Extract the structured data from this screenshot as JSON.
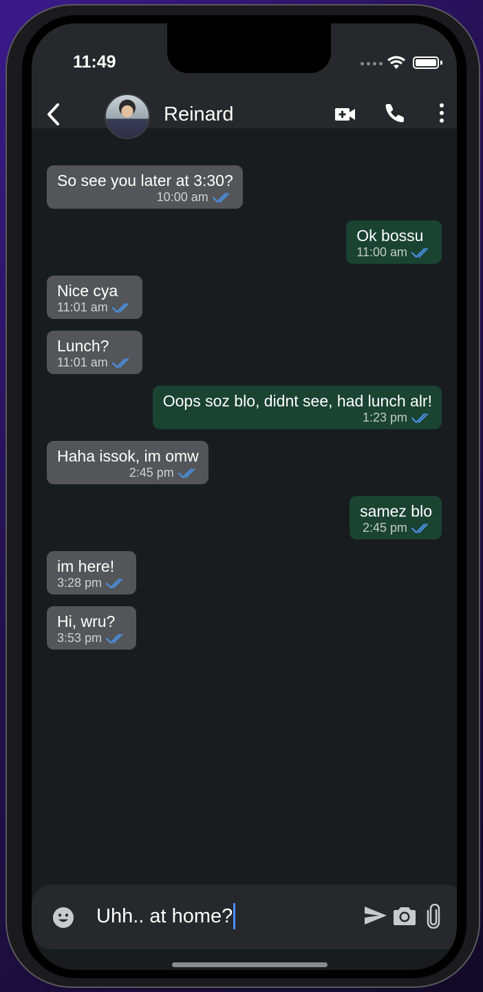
{
  "status_bar": {
    "time": "11:49"
  },
  "header": {
    "contact_name": "Reinard"
  },
  "messages": [
    {
      "direction": "in",
      "text": "So see you later at 3:30?",
      "time": "10:00 am"
    },
    {
      "direction": "out",
      "text": "Ok bossu",
      "time": "11:00 am"
    },
    {
      "direction": "in",
      "text": "Nice cya",
      "time": "11:01 am"
    },
    {
      "direction": "in",
      "text": "Lunch?",
      "time": "11:01 am"
    },
    {
      "direction": "out",
      "text": "Oops soz blo, didnt see, had lunch alr!",
      "time": "1:23 pm"
    },
    {
      "direction": "in",
      "text": "Haha issok, im omw",
      "time": "2:45 pm"
    },
    {
      "direction": "out",
      "text": "samez blo",
      "time": "2:45 pm"
    },
    {
      "direction": "in",
      "text": "im here!",
      "time": "3:28 pm"
    },
    {
      "direction": "in",
      "text": "Hi, wru?",
      "time": "3:53 pm"
    }
  ],
  "composer": {
    "value": "Uhh.. at home?"
  },
  "colors": {
    "incoming_bubble": "#545558",
    "outgoing_bubble": "#1a4332",
    "read_ticks": "#4a90e2",
    "background": "#181c1f",
    "header": "#26282b"
  },
  "icons": {
    "back": "chevron-left-icon",
    "video": "video-call-icon",
    "call": "phone-icon",
    "more": "more-vertical-icon",
    "emoji": "emoji-icon",
    "send": "send-icon",
    "camera": "camera-icon",
    "attach": "paperclip-icon",
    "read_status": "double-check-icon"
  }
}
